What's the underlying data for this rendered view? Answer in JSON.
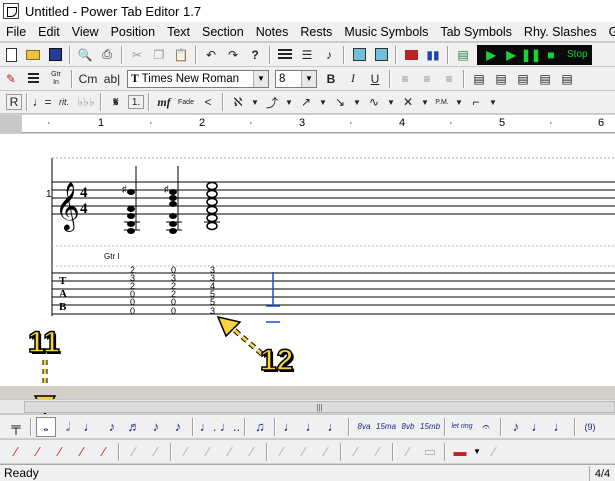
{
  "window": {
    "title": "Untitled - Power Tab Editor 1.7"
  },
  "menu": [
    "File",
    "Edit",
    "View",
    "Position",
    "Text",
    "Section",
    "Notes",
    "Rests",
    "Music Symbols",
    "Tab Symbols",
    "Rhy. Slashes",
    "Gui"
  ],
  "toolbar1": {
    "stop_label": "Stop"
  },
  "toolbar2": {
    "chord_label": "Cm",
    "text_label": "ab|",
    "guitar_in_label": "Gtr\nIn",
    "font_value": "Times New Roman",
    "font_size_value": "8",
    "bold_label": "B",
    "italic_label": "I",
    "underline_label": "U"
  },
  "toolbar3": {
    "rehearsal_label": "R",
    "rit_label": "rit.",
    "dynamic_label": "mf",
    "fade_label": "Fade",
    "pm_label": "P.M."
  },
  "ruler": {
    "marks": [
      "1",
      "2",
      "3",
      "4",
      "5",
      "6"
    ]
  },
  "score": {
    "staff_number": "1",
    "time_signature_top": "4",
    "time_signature_bottom": "4",
    "guitar_label": "Gtr I",
    "tab_letters": [
      "T",
      "A",
      "B"
    ],
    "columns": [
      {
        "frets": [
          "2",
          "3",
          "2",
          "0",
          "0",
          "0"
        ]
      },
      {
        "frets": [
          "0",
          "3",
          "2",
          "2",
          "0",
          "0"
        ]
      },
      {
        "frets": [
          "3",
          "3",
          "4",
          "5",
          "5",
          "3"
        ]
      }
    ]
  },
  "annotations": {
    "left_number": "11",
    "right_number": "12"
  },
  "bottom_bar1": {
    "ottava_label": "8va",
    "quindicesima_label": "15ma",
    "ottava_bassa_label": "8vb",
    "quindicesima_bassa_label": "15mb",
    "let_ring_label": "let ring",
    "tuplet_label": "(9)"
  },
  "status": {
    "text": "Ready",
    "page": "4/4"
  }
}
